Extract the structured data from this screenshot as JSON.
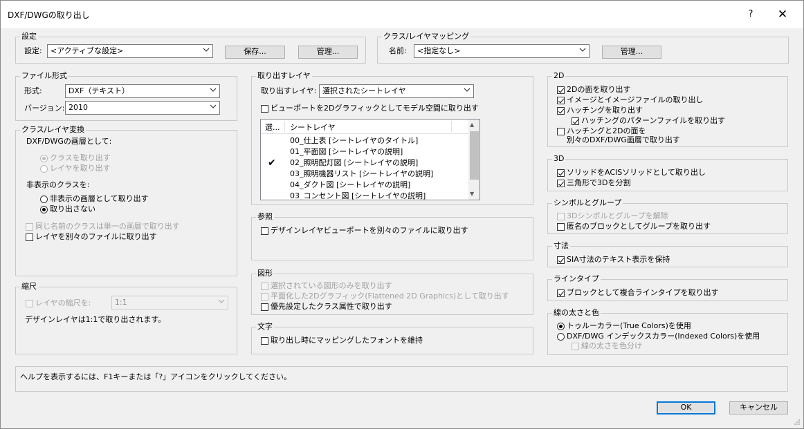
{
  "title": "DXF/DWGの取り出し",
  "help_label": "?",
  "close_label": "✕",
  "settings": {
    "legend": "設定",
    "label": "設定:",
    "value": "<アクティブな設定>",
    "save": "保存...",
    "manage": "管理..."
  },
  "mapping": {
    "legend": "クラス/レイヤマッピング",
    "label": "名前:",
    "value": "<指定なし>",
    "manage": "管理..."
  },
  "format": {
    "legend": "ファイル形式",
    "type_label": "形式:",
    "type_value": "DXF（テキスト）",
    "ver_label": "バージョン:",
    "ver_value": "2010"
  },
  "conv": {
    "legend": "クラス/レイヤ変換",
    "as_label": "DXF/DWGの画層として:",
    "opt_class": "クラスを取り出す",
    "opt_layer": "レイヤを取り出す",
    "hidden_label": "非表示のクラスを:",
    "hid_export": "非表示の画層として取り出す",
    "hid_none": "取り出さない",
    "same_name": "同じ名前のクラスは単一の画層で取り出す",
    "sep_files": "レイヤを別々のファイルに取り出す"
  },
  "scale": {
    "legend": "縮尺",
    "layer_scale": "レイヤの縮尺を:",
    "scale_value": "1:1",
    "note": "デザインレイヤは1:1で取り出されます。"
  },
  "export_layers": {
    "legend": "取り出すレイヤ",
    "label": "取り出すレイヤ:",
    "value": "選択されたシートレイヤ",
    "viewport_opt": "ビューポートを2Dグラフィックとしてモデル空間に取り出す",
    "col_sel": "選...",
    "col_sheet": "シートレイヤ",
    "rows": [
      "00_仕上表 [シートレイヤのタイトル]",
      "01_平面図 [シートレイヤの説明]",
      "02_照明配灯図 [シートレイヤの説明]",
      "03_照明機器リスト [シートレイヤの説明]",
      "04_ダクト図 [シートレイヤの説明]",
      "03_コンセント図 [シートレイヤの説明]"
    ],
    "check": "✔"
  },
  "ref": {
    "legend": "参照",
    "opt": "デザインレイヤビューポートを別々のファイルに取り出す"
  },
  "shapes": {
    "legend": "図形",
    "sel_only": "選択されている図形のみを取り出す",
    "flattened": "平面化した2Dグラフィック(Flattened 2D Graphics)として取り出す",
    "class_attr": "優先設定したクラス属性で取り出す"
  },
  "text": {
    "legend": "文字",
    "opt": "取り出し時にマッピングしたフォントを維持"
  },
  "d2": {
    "legend": "2D",
    "faces": "2Dの面を取り出す",
    "images": "イメージとイメージファイルの取り出し",
    "hatch": "ハッチングを取り出す",
    "hatch_pat": "ハッチングのパターンファイルを取り出す",
    "hatch_sep1": "ハッチングと2Dの面を",
    "hatch_sep2": "別々のDXF/DWG画層で取り出す"
  },
  "d3": {
    "legend": "3D",
    "acis": "ソリッドをACISソリッドとして取り出し",
    "tri": "三角形で3Dを分割"
  },
  "sym": {
    "legend": "シンボルとグループ",
    "ungroup": "3Dシンボルとグループを解除",
    "anon": "匿名のブロックとしてグループを取り出す"
  },
  "dim": {
    "legend": "寸法",
    "sia": "SIA寸法のテキスト表示を保持"
  },
  "ltype": {
    "legend": "ラインタイプ",
    "compound": "ブロックとして複合ラインタイプを取り出す"
  },
  "lw": {
    "legend": "線の太さと色",
    "true_color": "トゥルーカラー(True Colors)を使用",
    "indexed": "DXF/DWG インデックスカラー(Indexed Colors)を使用",
    "by_color": "線の太さを色分け"
  },
  "status": "ヘルプを表示するには、F1キーまたは「?」アイコンをクリックしてください。",
  "ok": "OK",
  "cancel": "キャンセル"
}
